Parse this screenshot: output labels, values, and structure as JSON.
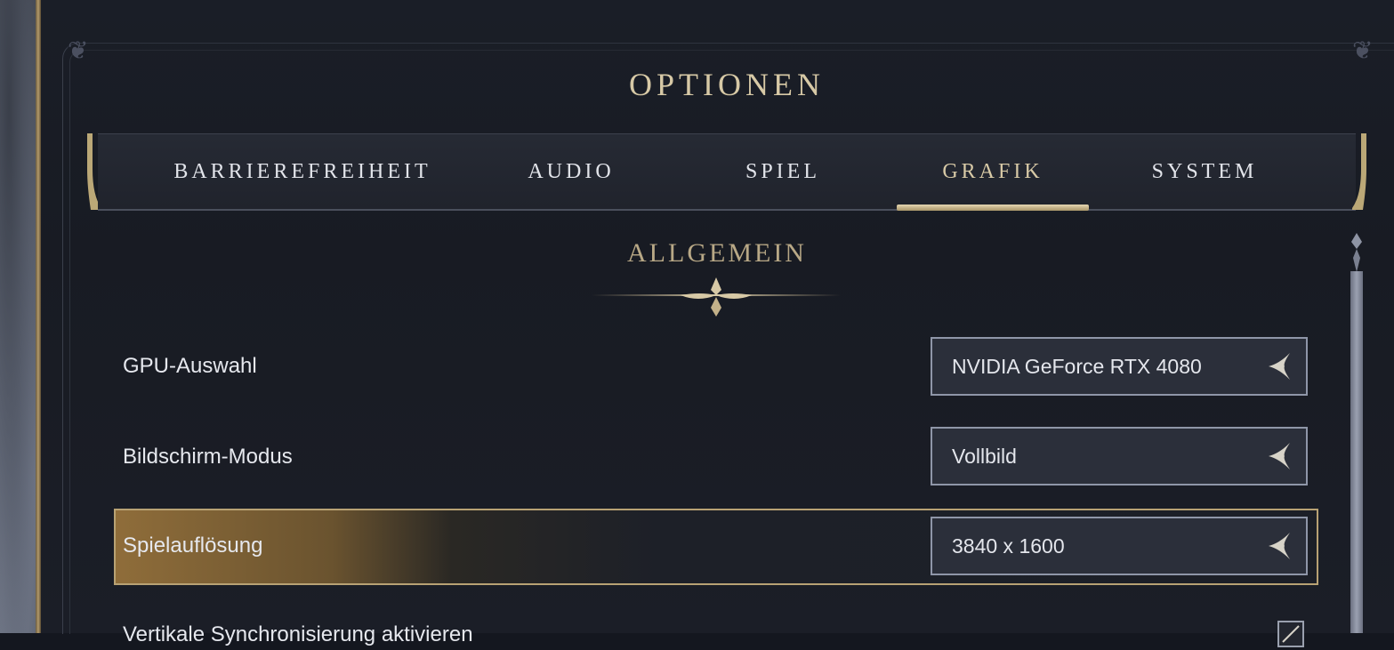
{
  "title": "OPTIONEN",
  "tabs": [
    {
      "label": "BARRIEREFREIHEIT",
      "active": false
    },
    {
      "label": "AUDIO",
      "active": false
    },
    {
      "label": "SPIEL",
      "active": false
    },
    {
      "label": "GRAFIK",
      "active": true
    },
    {
      "label": "SYSTEM",
      "active": false
    }
  ],
  "section": {
    "title": "ALLGEMEIN"
  },
  "settings": [
    {
      "label": "GPU-Auswahl",
      "value": "NVIDIA GeForce RTX 4080",
      "control": "dropdown",
      "highlighted": false
    },
    {
      "label": "Bildschirm-Modus",
      "value": "Vollbild",
      "control": "dropdown",
      "highlighted": false
    },
    {
      "label": "Spielauflösung",
      "value": "3840 x 1600",
      "control": "dropdown",
      "highlighted": true
    },
    {
      "label": "Vertikale Synchronisierung aktivieren",
      "control": "checkbox",
      "checked": true,
      "highlighted": false
    }
  ],
  "colors": {
    "accent_gold": "#d7c9a6",
    "highlight_gold": "#8f6d3a",
    "panel_bg": "#1a1e27"
  },
  "icons": {
    "dropdown_arrow": "ornate-arrow-icon",
    "section_divider": "fleur-ornament-icon"
  }
}
